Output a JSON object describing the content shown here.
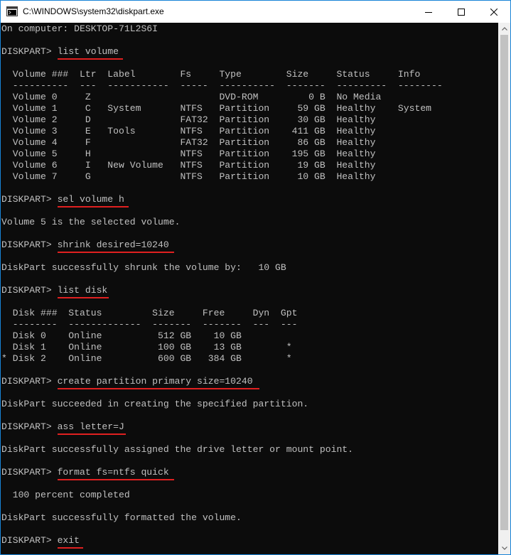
{
  "window": {
    "title": "C:\\WINDOWS\\system32\\diskpart.exe",
    "icon": "console-icon",
    "controls": {
      "minimize": "minimize-icon",
      "maximize": "maximize-icon",
      "close": "close-icon"
    },
    "accent_color": "#1883d7"
  },
  "colors": {
    "background": "#0c0c0c",
    "text": "#c0c0c0",
    "underline": "#e02020"
  },
  "terminal": {
    "lines": [
      "On computer: DESKTOP-71L2S6I",
      "",
      "DISKPART> list volume",
      "",
      "  Volume ###  Ltr  Label        Fs     Type        Size     Status     Info",
      "  ----------  ---  -----------  -----  ----------  -------  ---------  --------",
      "  Volume 0     Z                       DVD-ROM         0 B  No Media",
      "  Volume 1     C   System       NTFS   Partition     59 GB  Healthy    System",
      "  Volume 2     D                FAT32  Partition     30 GB  Healthy",
      "  Volume 3     E   Tools        NTFS   Partition    411 GB  Healthy",
      "  Volume 4     F                FAT32  Partition     86 GB  Healthy",
      "  Volume 5     H                NTFS   Partition    195 GB  Healthy",
      "  Volume 6     I   New Volume   NTFS   Partition     19 GB  Healthy",
      "  Volume 7     G                NTFS   Partition     10 GB  Healthy",
      "",
      "DISKPART> sel volume h",
      "",
      "Volume 5 is the selected volume.",
      "",
      "DISKPART> shrink desired=10240",
      "",
      "DiskPart successfully shrunk the volume by:   10 GB",
      "",
      "DISKPART> list disk",
      "",
      "  Disk ###  Status         Size     Free     Dyn  Gpt",
      "  --------  -------------  -------  -------  ---  ---",
      "  Disk 0    Online          512 GB    10 GB",
      "  Disk 1    Online          100 GB    13 GB        *",
      "* Disk 2    Online          600 GB   384 GB        *",
      "",
      "DISKPART> create partition primary size=10240",
      "",
      "DiskPart succeeded in creating the specified partition.",
      "",
      "DISKPART> ass letter=J",
      "",
      "DiskPart successfully assigned the drive letter or mount point.",
      "",
      "DISKPART> format fs=ntfs quick",
      "",
      "  100 percent completed",
      "",
      "DiskPart successfully formatted the volume.",
      "",
      "DISKPART> exit"
    ]
  }
}
